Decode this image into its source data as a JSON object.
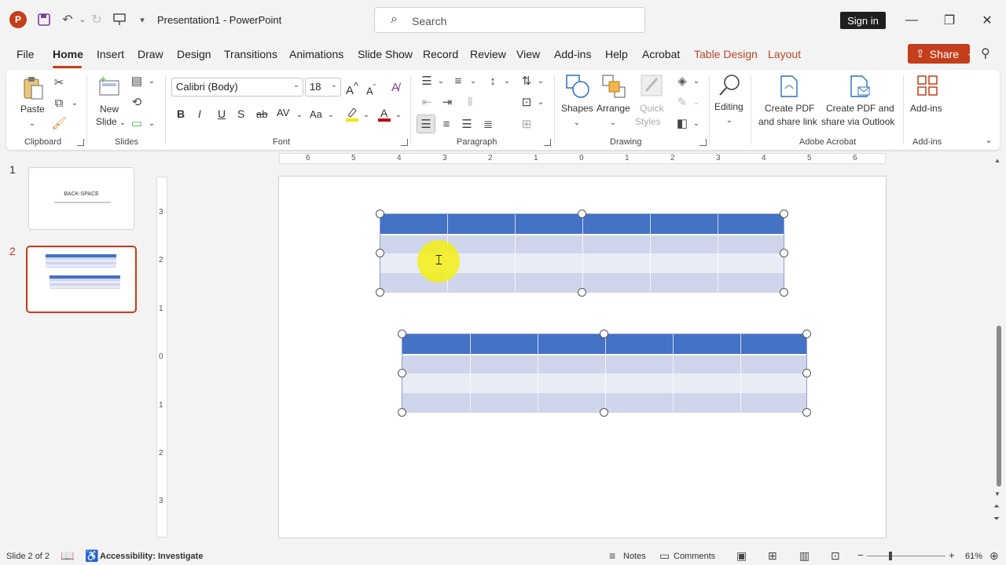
{
  "titlebar": {
    "logo": "P",
    "doc_title": "Presentation1  -  PowerPoint",
    "search_placeholder": "Search",
    "signin_label": "Sign in"
  },
  "menu": {
    "tabs": [
      "File",
      "Home",
      "Insert",
      "Draw",
      "Design",
      "Transitions",
      "Animations",
      "Slide Show",
      "Record",
      "Review",
      "View",
      "Add-ins",
      "Help",
      "Acrobat",
      "Table Design",
      "Layout"
    ],
    "active_tab": "Home",
    "share_label": "Share"
  },
  "ribbon": {
    "clipboard": {
      "paste": "Paste",
      "group": "Clipboard"
    },
    "slides": {
      "new_slide_1": "New",
      "new_slide_2": "Slide",
      "group": "Slides"
    },
    "font": {
      "name": "Calibri (Body)",
      "size": "18",
      "bold": "B",
      "italic": "I",
      "underline": "U",
      "strike": "S",
      "strike2": "ab",
      "spacing": "AV",
      "case": "Aa",
      "grow": "A",
      "shrink": "A",
      "group": "Font"
    },
    "paragraph": {
      "group": "Paragraph"
    },
    "drawing": {
      "shapes": "Shapes",
      "arrange": "Arrange",
      "quick_styles_1": "Quick",
      "quick_styles_2": "Styles",
      "group": "Drawing"
    },
    "editing": {
      "label": "Editing"
    },
    "acrobat": {
      "create_pdf_1": "Create PDF",
      "create_pdf_2": "and share link",
      "outlook_1": "Create PDF and",
      "outlook_2": "share via Outlook",
      "group": "Adobe Acrobat"
    },
    "addins": {
      "label": "Add-ins",
      "group": "Add-ins"
    }
  },
  "slides_panel": {
    "thumb1_number": "1",
    "thumb1_title": "BACK-SPACE",
    "thumb2_number": "2"
  },
  "ruler": {
    "h_numbers": [
      "6",
      "5",
      "4",
      "3",
      "2",
      "1",
      "0",
      "1",
      "2",
      "3",
      "4",
      "5",
      "6"
    ],
    "v_numbers": [
      "3",
      "2",
      "1",
      "0",
      "1",
      "2",
      "3"
    ]
  },
  "colors": {
    "accent": "#c43e1c",
    "table_header": "#4472c4",
    "table_band_dark": "#cfd5ea",
    "table_band_light": "#e9ebf5"
  },
  "statusbar": {
    "slide_info": "Slide 2 of 2",
    "accessibility": "Accessibility: Investigate",
    "notes": "Notes",
    "comments": "Comments",
    "zoom_minus": "−",
    "zoom_plus": "+",
    "zoom": "61%"
  }
}
